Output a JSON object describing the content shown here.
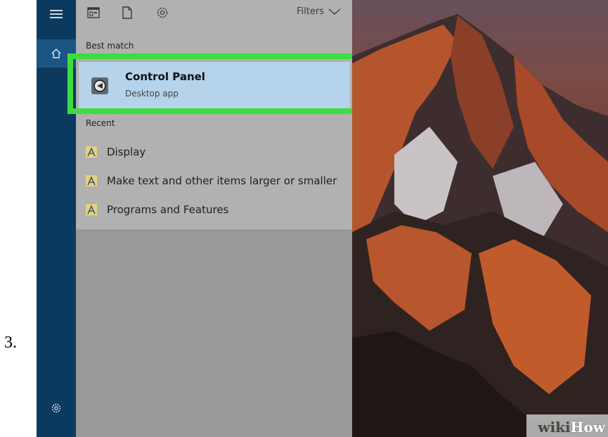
{
  "step_number": "3.",
  "toolbar": {
    "icons": [
      "apps-icon",
      "document-icon",
      "settings-gear-icon"
    ],
    "filters_label": "Filters"
  },
  "sidebar": {
    "icons": [
      "hamburger-menu-icon",
      "home-icon",
      "settings-gear-icon"
    ]
  },
  "best_match": {
    "section_label": "Best match",
    "title": "Control Panel",
    "subtitle": "Desktop app",
    "highlight_color": "#3fdc40",
    "selected_bg": "#b5d3ea"
  },
  "recent": {
    "section_label": "Recent",
    "items": [
      {
        "label": "Display",
        "icon": "settings-document-icon"
      },
      {
        "label": "Make text and other items larger or smaller",
        "icon": "settings-document-icon"
      },
      {
        "label": "Programs and Features",
        "icon": "settings-document-icon"
      }
    ]
  },
  "watermark": {
    "part1": "wiki",
    "part2": "How"
  },
  "colors": {
    "sidebar_bg": "#0c3a5e",
    "panel_bg": "#b1b1b1",
    "wallpaper_tone": "#6a3d33"
  }
}
